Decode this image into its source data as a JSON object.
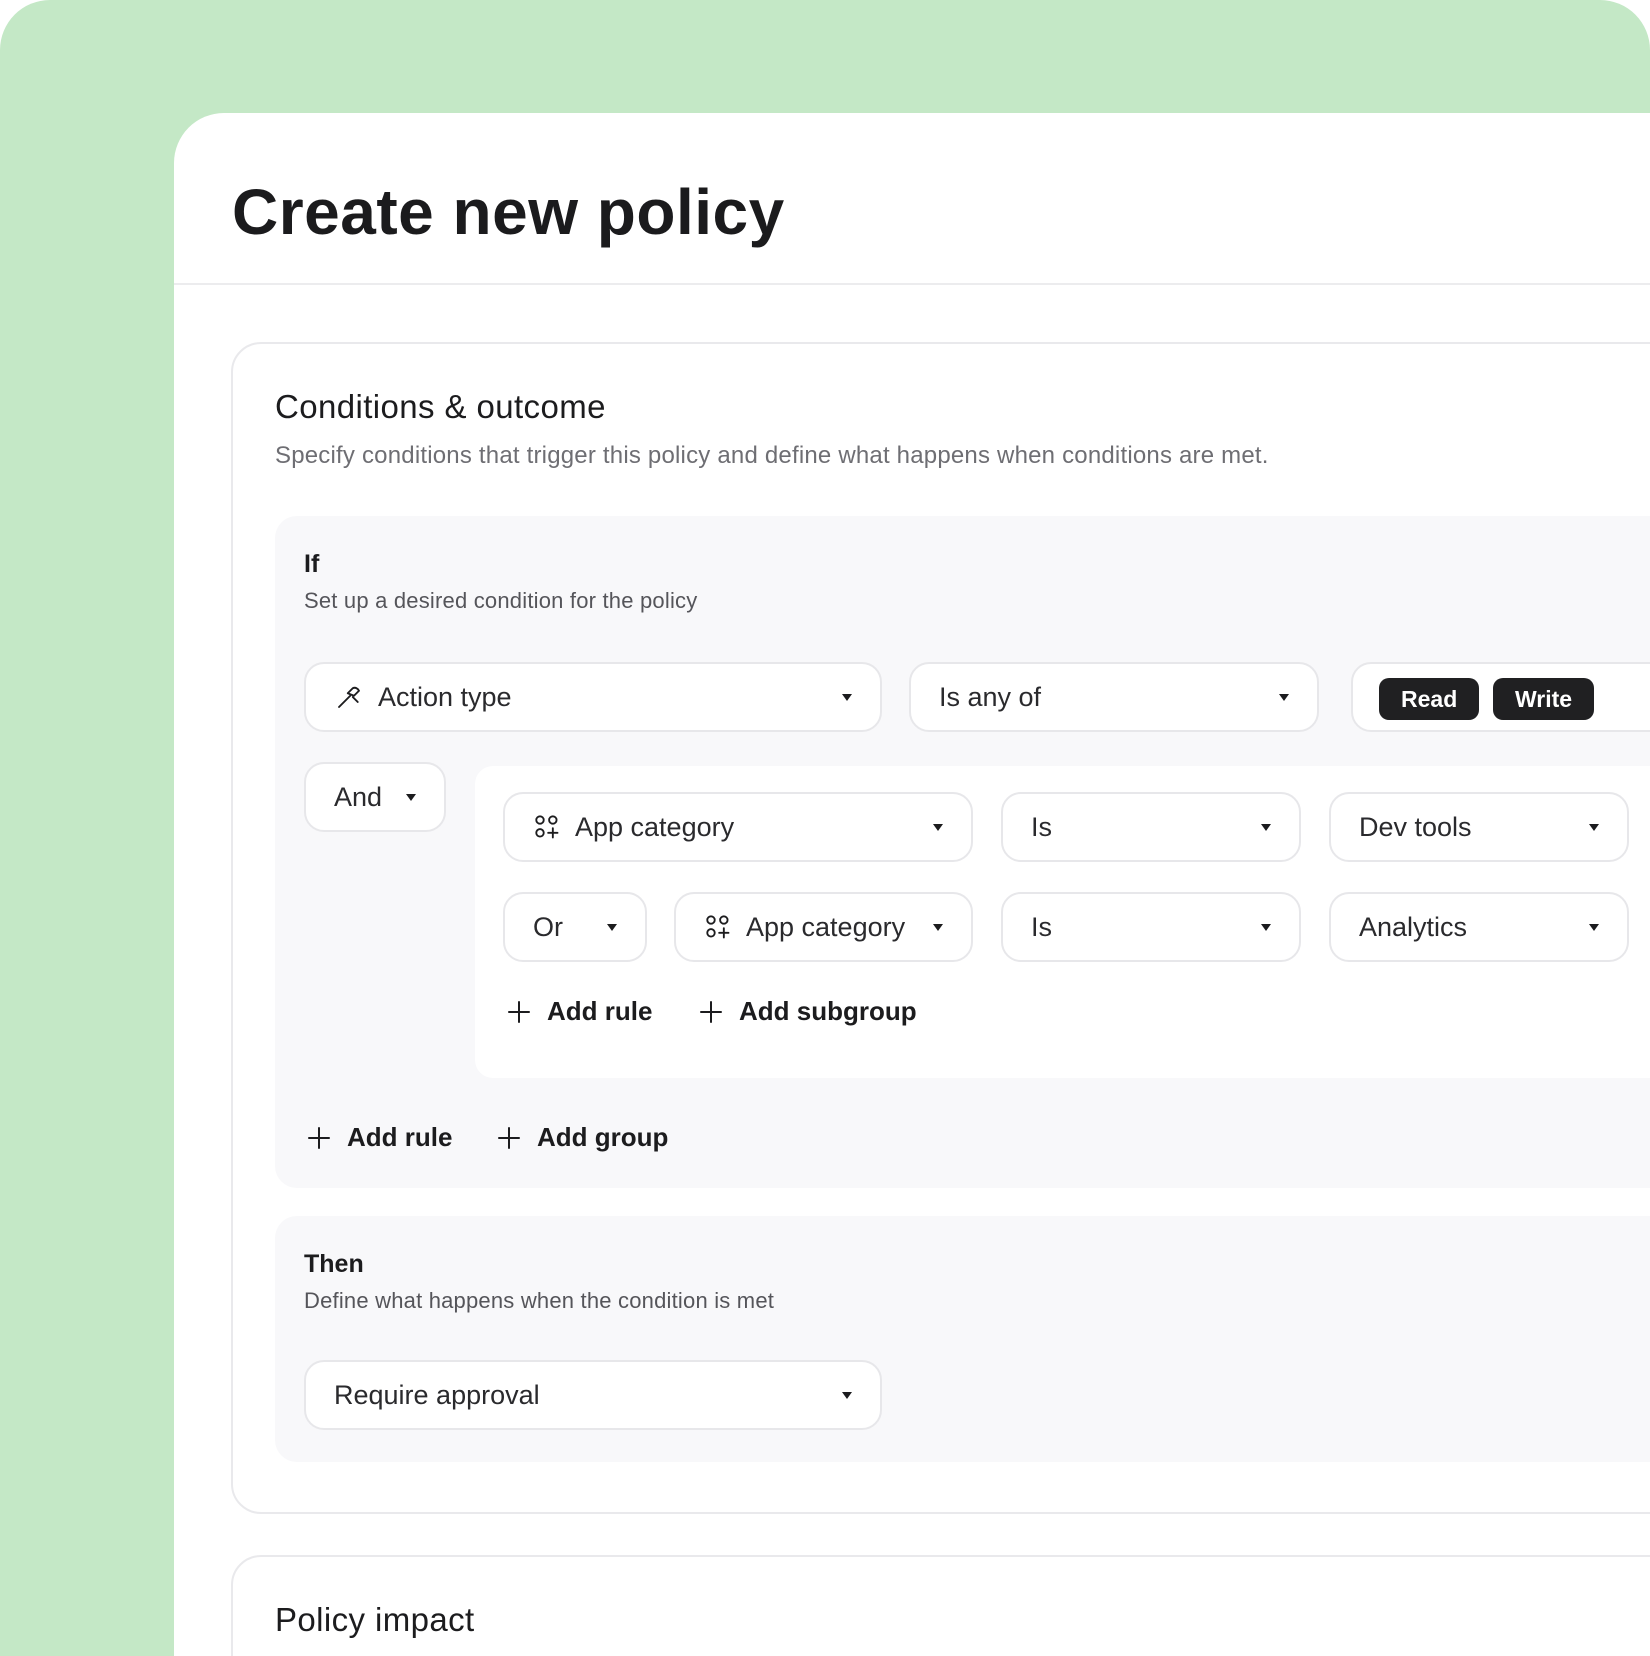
{
  "page": {
    "title": "Create new policy"
  },
  "conditions": {
    "title": "Conditions & outcome",
    "subtitle": "Specify conditions that trigger this policy and define what happens when conditions are met.",
    "if": {
      "title": "If",
      "subtitle": "Set up a desired condition for the policy",
      "rule1": {
        "field": "Action type",
        "operator": "Is any of",
        "values": [
          "Read",
          "Write"
        ]
      },
      "group_join": "And",
      "subgroup": {
        "rule1": {
          "field": "App category",
          "operator": "Is",
          "value": "Dev tools"
        },
        "rule2": {
          "join": "Or",
          "field": "App category",
          "operator": "Is",
          "value": "Analytics"
        },
        "add_rule": "Add rule",
        "add_subgroup": "Add subgroup"
      },
      "add_rule": "Add rule",
      "add_group": "Add group"
    },
    "then": {
      "title": "Then",
      "subtitle": "Define what happens when the condition is met",
      "outcome": "Require approval"
    }
  },
  "impact": {
    "title": "Policy impact"
  },
  "colors": {
    "frame": "#c4e8c6",
    "chip": "#202022",
    "section_bg": "#f8f8fa"
  },
  "icons": {
    "action_type": "hammer-icon",
    "app_category": "app-grid-icon",
    "add": "plus-icon",
    "dropdown": "caret-down-icon"
  }
}
